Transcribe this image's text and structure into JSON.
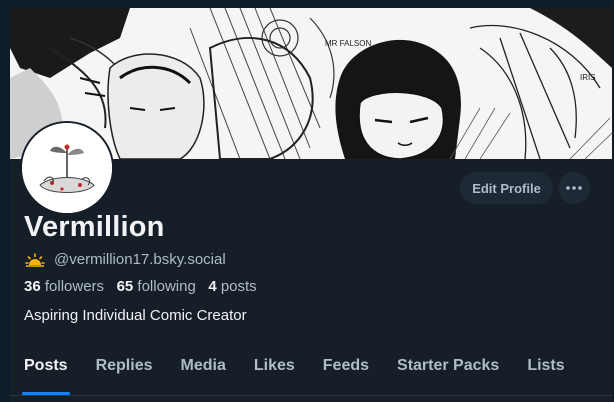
{
  "profile": {
    "display_name": "Vermillion",
    "handle": "@vermillion17.bsky.social",
    "bio": "Aspiring Individual Comic Creator",
    "status_emoji_icon": "sun-icon"
  },
  "stats": {
    "followers_count": "36",
    "followers_label": "followers",
    "following_count": "65",
    "following_label": "following",
    "posts_count": "4",
    "posts_label": "posts"
  },
  "actions": {
    "edit_profile_label": "Edit Profile",
    "more_icon": "ellipsis-icon"
  },
  "banner": {
    "sketch_labels": [
      "MR FALSON",
      "IRIS"
    ]
  },
  "tabs": [
    {
      "label": "Posts",
      "active": true
    },
    {
      "label": "Replies",
      "active": false
    },
    {
      "label": "Media",
      "active": false
    },
    {
      "label": "Likes",
      "active": false
    },
    {
      "label": "Feeds",
      "active": false
    },
    {
      "label": "Starter Packs",
      "active": false
    },
    {
      "label": "Lists",
      "active": false
    }
  ],
  "colors": {
    "background": "#161e27",
    "outer_background": "#0e1b2a",
    "primary_text": "#f1f3f5",
    "secondary_text": "#aebbc9",
    "accent": "#1083fe",
    "button_bg": "#1e2936"
  }
}
